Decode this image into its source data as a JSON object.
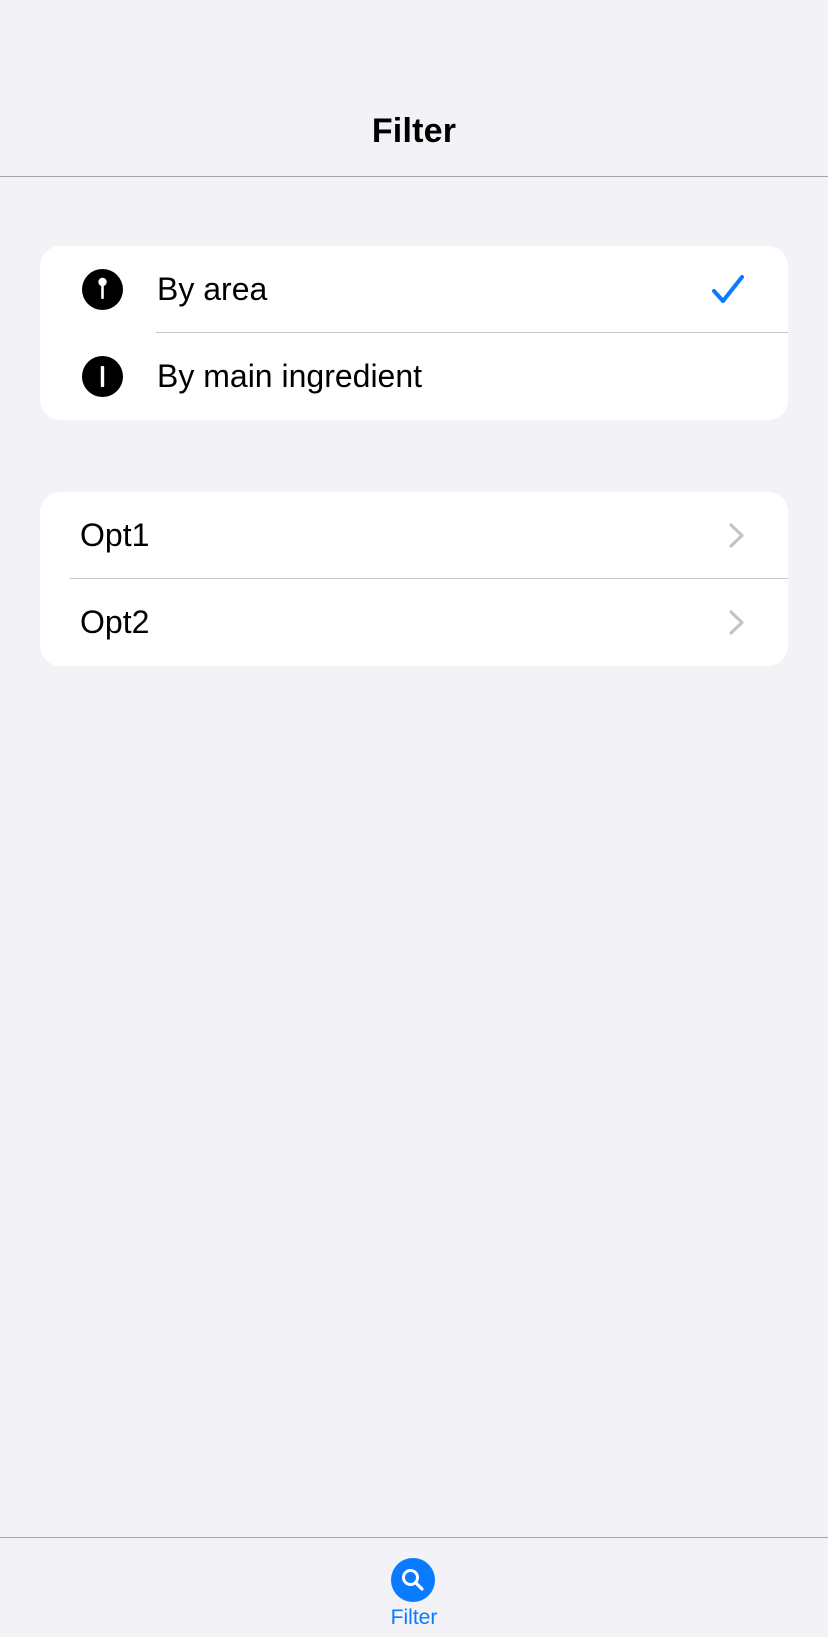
{
  "header": {
    "title": "Filter"
  },
  "filter_types": [
    {
      "label": "By area",
      "icon": "pin-icon",
      "selected": true
    },
    {
      "label": "By main ingredient",
      "icon": "info-icon",
      "selected": false
    }
  ],
  "options": [
    {
      "label": "Opt1"
    },
    {
      "label": "Opt2"
    }
  ],
  "tab_bar": {
    "items": [
      {
        "label": "Filter",
        "icon": "search-icon",
        "active": true
      }
    ]
  },
  "colors": {
    "accent": "#0a7aff",
    "background": "#f2f2f7",
    "cell": "#ffffff",
    "separator": "#c6c6c8",
    "chevron": "#c4c4c7"
  }
}
